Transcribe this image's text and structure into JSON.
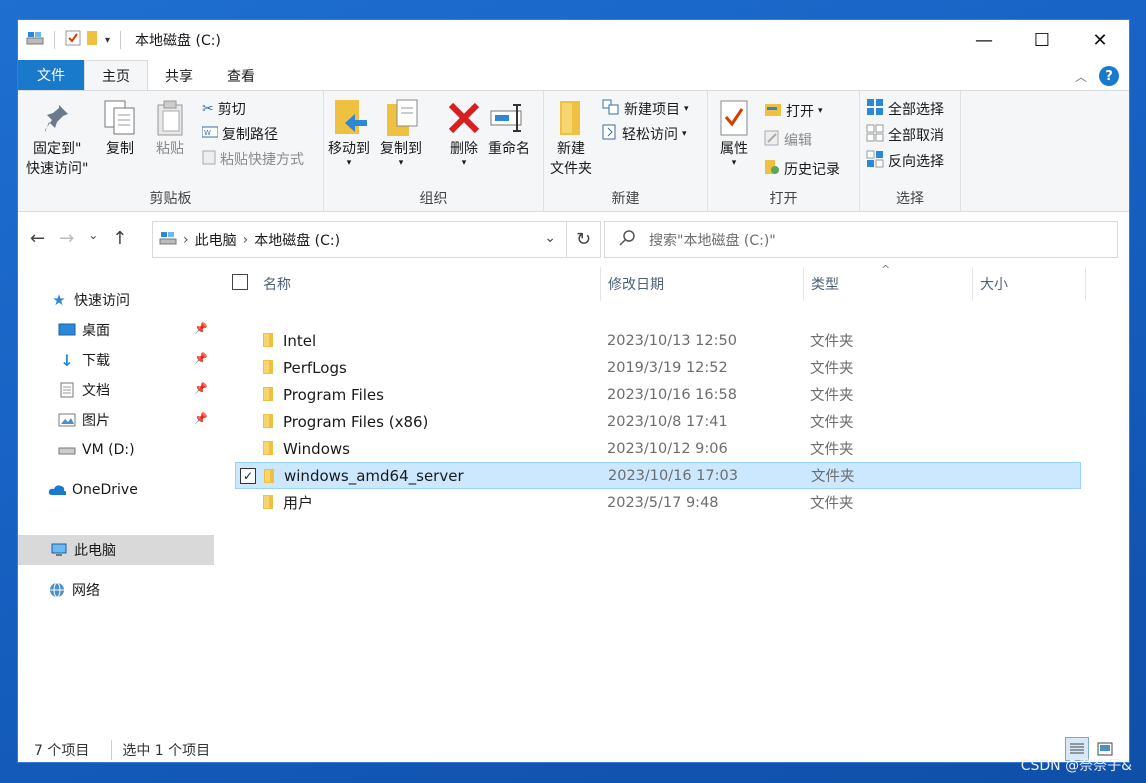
{
  "window": {
    "title": "本地磁盘 (C:)",
    "controls": {
      "minimize": "—",
      "maximize": "☐",
      "close": "✕"
    }
  },
  "ribbon": {
    "tabs": [
      {
        "label": "文件"
      },
      {
        "label": "主页"
      },
      {
        "label": "共享"
      },
      {
        "label": "查看"
      }
    ],
    "clipboard": {
      "pin_line1": "固定到\"",
      "pin_line2": "快速访问\"",
      "copy": "复制",
      "paste": "粘贴",
      "cut": "剪切",
      "copy_path": "复制路径",
      "paste_shortcut": "粘贴快捷方式",
      "label": "剪贴板"
    },
    "organize": {
      "move_to": "移动到",
      "copy_to": "复制到",
      "delete": "删除",
      "rename": "重命名",
      "label": "组织"
    },
    "new": {
      "new_folder_line1": "新建",
      "new_folder_line2": "文件夹",
      "new_item": "新建项目",
      "easy_access": "轻松访问",
      "label": "新建"
    },
    "open": {
      "properties": "属性",
      "open": "打开",
      "edit": "编辑",
      "history": "历史记录",
      "label": "打开"
    },
    "select": {
      "select_all": "全部选择",
      "select_none": "全部取消",
      "invert": "反向选择",
      "label": "选择"
    }
  },
  "address": {
    "crumbs": [
      "此电脑",
      "本地磁盘 (C:)"
    ],
    "search_placeholder": "搜索\"本地磁盘 (C:)\""
  },
  "navpane": {
    "quick_access": "快速访问",
    "items": [
      {
        "label": "桌面",
        "pinned": true
      },
      {
        "label": "下载",
        "pinned": true
      },
      {
        "label": "文档",
        "pinned": true
      },
      {
        "label": "图片",
        "pinned": true
      },
      {
        "label": "VM (D:)",
        "pinned": false
      }
    ],
    "onedrive": "OneDrive",
    "this_pc": "此电脑",
    "network": "网络"
  },
  "columns": {
    "name": "名称",
    "date": "修改日期",
    "type": "类型",
    "size": "大小"
  },
  "files": [
    {
      "name": "Intel",
      "date": "2023/10/13 12:50",
      "type": "文件夹",
      "selected": false
    },
    {
      "name": "PerfLogs",
      "date": "2019/3/19 12:52",
      "type": "文件夹",
      "selected": false
    },
    {
      "name": "Program Files",
      "date": "2023/10/16 16:58",
      "type": "文件夹",
      "selected": false
    },
    {
      "name": "Program Files (x86)",
      "date": "2023/10/8 17:41",
      "type": "文件夹",
      "selected": false
    },
    {
      "name": "Windows",
      "date": "2023/10/12 9:06",
      "type": "文件夹",
      "selected": false
    },
    {
      "name": "windows_amd64_server",
      "date": "2023/10/16 17:03",
      "type": "文件夹",
      "selected": true
    },
    {
      "name": "用户",
      "date": "2023/5/17 9:48",
      "type": "文件夹",
      "selected": false
    }
  ],
  "status": {
    "item_count": "7 个项目",
    "selected_count": "选中 1 个项目"
  },
  "watermark": "CSDN @奈奈子&",
  "colors": {
    "accent": "#1979ca",
    "selection": "#cce8ff",
    "folder": "#f0c040"
  }
}
